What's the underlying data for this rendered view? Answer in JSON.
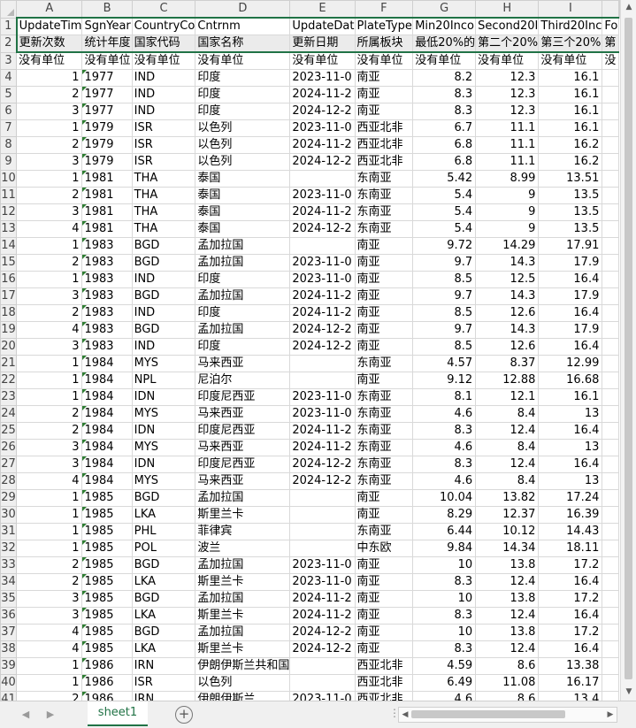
{
  "sheet": {
    "columns": [
      "A",
      "B",
      "C",
      "D",
      "E",
      "F",
      "G",
      "H",
      "I"
    ],
    "rows": [
      {
        "n": "1",
        "cells": [
          "UpdateTim",
          "SgnYear",
          "CountryCo",
          "Cntrnm",
          "UpdateDat",
          "PlateType",
          "Min20Inco",
          "Second20I",
          "Third20Inc",
          "Fo"
        ]
      },
      {
        "n": "2",
        "cells": [
          "更新次数",
          "统计年度",
          "国家代码",
          "国家名称",
          "更新日期",
          "所属板块",
          "最低20%的",
          "第二个20%",
          "第三个20%",
          "第"
        ]
      },
      {
        "n": "3",
        "cells": [
          "没有单位",
          "没有单位",
          "没有单位",
          "没有单位",
          "没有单位",
          "没有单位",
          "没有单位",
          "没有单位",
          "没有单位",
          "没"
        ]
      },
      {
        "n": "4",
        "cells": [
          "1",
          "1977",
          "IND",
          "印度",
          "2023-11-0",
          "南亚",
          "8.2",
          "12.3",
          "16.1"
        ]
      },
      {
        "n": "5",
        "cells": [
          "2",
          "1977",
          "IND",
          "印度",
          "2024-11-2",
          "南亚",
          "8.3",
          "12.3",
          "16.1"
        ]
      },
      {
        "n": "6",
        "cells": [
          "3",
          "1977",
          "IND",
          "印度",
          "2024-12-2",
          "南亚",
          "8.3",
          "12.3",
          "16.1"
        ]
      },
      {
        "n": "7",
        "cells": [
          "1",
          "1979",
          "ISR",
          "以色列",
          "2023-11-0",
          "西亚北非",
          "6.7",
          "11.1",
          "16.1"
        ]
      },
      {
        "n": "8",
        "cells": [
          "2",
          "1979",
          "ISR",
          "以色列",
          "2024-11-2",
          "西亚北非",
          "6.8",
          "11.1",
          "16.2"
        ]
      },
      {
        "n": "9",
        "cells": [
          "3",
          "1979",
          "ISR",
          "以色列",
          "2024-12-2",
          "西亚北非",
          "6.8",
          "11.1",
          "16.2"
        ]
      },
      {
        "n": "10",
        "cells": [
          "1",
          "1981",
          "THA",
          "泰国",
          "",
          "东南亚",
          "5.42",
          "8.99",
          "13.51"
        ]
      },
      {
        "n": "11",
        "cells": [
          "2",
          "1981",
          "THA",
          "泰国",
          "2023-11-0",
          "东南亚",
          "5.4",
          "9",
          "13.5"
        ]
      },
      {
        "n": "12",
        "cells": [
          "3",
          "1981",
          "THA",
          "泰国",
          "2024-11-2",
          "东南亚",
          "5.4",
          "9",
          "13.5"
        ]
      },
      {
        "n": "13",
        "cells": [
          "4",
          "1981",
          "THA",
          "泰国",
          "2024-12-2",
          "东南亚",
          "5.4",
          "9",
          "13.5"
        ]
      },
      {
        "n": "14",
        "cells": [
          "1",
          "1983",
          "BGD",
          "孟加拉国",
          "",
          "南亚",
          "9.72",
          "14.29",
          "17.91"
        ]
      },
      {
        "n": "15",
        "cells": [
          "2",
          "1983",
          "BGD",
          "孟加拉国",
          "2023-11-0",
          "南亚",
          "9.7",
          "14.3",
          "17.9"
        ]
      },
      {
        "n": "16",
        "cells": [
          "1",
          "1983",
          "IND",
          "印度",
          "2023-11-0",
          "南亚",
          "8.5",
          "12.5",
          "16.4"
        ]
      },
      {
        "n": "17",
        "cells": [
          "3",
          "1983",
          "BGD",
          "孟加拉国",
          "2024-11-2",
          "南亚",
          "9.7",
          "14.3",
          "17.9"
        ]
      },
      {
        "n": "18",
        "cells": [
          "2",
          "1983",
          "IND",
          "印度",
          "2024-11-2",
          "南亚",
          "8.5",
          "12.6",
          "16.4"
        ]
      },
      {
        "n": "19",
        "cells": [
          "4",
          "1983",
          "BGD",
          "孟加拉国",
          "2024-12-2",
          "南亚",
          "9.7",
          "14.3",
          "17.9"
        ]
      },
      {
        "n": "20",
        "cells": [
          "3",
          "1983",
          "IND",
          "印度",
          "2024-12-2",
          "南亚",
          "8.5",
          "12.6",
          "16.4"
        ]
      },
      {
        "n": "21",
        "cells": [
          "1",
          "1984",
          "MYS",
          "马来西亚",
          "",
          "东南亚",
          "4.57",
          "8.37",
          "12.99"
        ]
      },
      {
        "n": "22",
        "cells": [
          "1",
          "1984",
          "NPL",
          "尼泊尔",
          "",
          "南亚",
          "9.12",
          "12.88",
          "16.68"
        ]
      },
      {
        "n": "23",
        "cells": [
          "1",
          "1984",
          "IDN",
          "印度尼西亚",
          "2023-11-0",
          "东南亚",
          "8.1",
          "12.1",
          "16.1"
        ]
      },
      {
        "n": "24",
        "cells": [
          "2",
          "1984",
          "MYS",
          "马来西亚",
          "2023-11-0",
          "东南亚",
          "4.6",
          "8.4",
          "13"
        ]
      },
      {
        "n": "25",
        "cells": [
          "2",
          "1984",
          "IDN",
          "印度尼西亚",
          "2024-11-2",
          "东南亚",
          "8.3",
          "12.4",
          "16.4"
        ]
      },
      {
        "n": "26",
        "cells": [
          "3",
          "1984",
          "MYS",
          "马来西亚",
          "2024-11-2",
          "东南亚",
          "4.6",
          "8.4",
          "13"
        ]
      },
      {
        "n": "27",
        "cells": [
          "3",
          "1984",
          "IDN",
          "印度尼西亚",
          "2024-12-2",
          "东南亚",
          "8.3",
          "12.4",
          "16.4"
        ]
      },
      {
        "n": "28",
        "cells": [
          "4",
          "1984",
          "MYS",
          "马来西亚",
          "2024-12-2",
          "东南亚",
          "4.6",
          "8.4",
          "13"
        ]
      },
      {
        "n": "29",
        "cells": [
          "1",
          "1985",
          "BGD",
          "孟加拉国",
          "",
          "南亚",
          "10.04",
          "13.82",
          "17.24"
        ]
      },
      {
        "n": "30",
        "cells": [
          "1",
          "1985",
          "LKA",
          "斯里兰卡",
          "",
          "南亚",
          "8.29",
          "12.37",
          "16.39"
        ]
      },
      {
        "n": "31",
        "cells": [
          "1",
          "1985",
          "PHL",
          "菲律宾",
          "",
          "东南亚",
          "6.44",
          "10.12",
          "14.43"
        ]
      },
      {
        "n": "32",
        "cells": [
          "1",
          "1985",
          "POL",
          "波兰",
          "",
          "中东欧",
          "9.84",
          "14.34",
          "18.11"
        ]
      },
      {
        "n": "33",
        "cells": [
          "2",
          "1985",
          "BGD",
          "孟加拉国",
          "2023-11-0",
          "南亚",
          "10",
          "13.8",
          "17.2"
        ]
      },
      {
        "n": "34",
        "cells": [
          "2",
          "1985",
          "LKA",
          "斯里兰卡",
          "2023-11-0",
          "南亚",
          "8.3",
          "12.4",
          "16.4"
        ]
      },
      {
        "n": "35",
        "cells": [
          "3",
          "1985",
          "BGD",
          "孟加拉国",
          "2024-11-2",
          "南亚",
          "10",
          "13.8",
          "17.2"
        ]
      },
      {
        "n": "36",
        "cells": [
          "3",
          "1985",
          "LKA",
          "斯里兰卡",
          "2024-11-2",
          "南亚",
          "8.3",
          "12.4",
          "16.4"
        ]
      },
      {
        "n": "37",
        "cells": [
          "4",
          "1985",
          "BGD",
          "孟加拉国",
          "2024-12-2",
          "南亚",
          "10",
          "13.8",
          "17.2"
        ]
      },
      {
        "n": "38",
        "cells": [
          "4",
          "1985",
          "LKA",
          "斯里兰卡",
          "2024-12-2",
          "南亚",
          "8.3",
          "12.4",
          "16.4"
        ]
      },
      {
        "n": "39",
        "cells": [
          "1",
          "1986",
          "IRN",
          "伊朗伊斯兰共和国",
          "",
          "西亚北非",
          "4.59",
          "8.6",
          "13.38"
        ]
      },
      {
        "n": "40",
        "cells": [
          "1",
          "1986",
          "ISR",
          "以色列",
          "",
          "西亚北非",
          "6.49",
          "11.08",
          "16.17"
        ]
      },
      {
        "n": "41",
        "cells": [
          "2",
          "1986",
          "IRN",
          "伊朗伊斯兰",
          "2023-11-0",
          "西亚北非",
          "4.6",
          "8.6",
          "13.4"
        ]
      }
    ]
  },
  "tabs": {
    "active": "sheet1"
  },
  "nav": {
    "prev": "◀",
    "next": "▶",
    "add": "+",
    "sep": "⋮"
  },
  "scroll": {
    "up": "▲",
    "down": "▼",
    "left": "◀",
    "right": "▶"
  }
}
